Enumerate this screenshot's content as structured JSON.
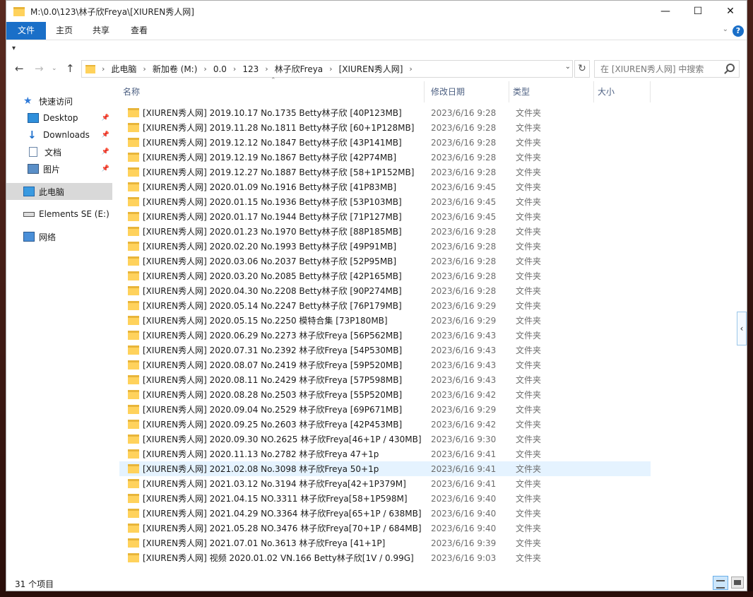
{
  "window": {
    "title": "M:\\0.0\\123\\林子欣Freya\\[XIUREN秀人网]",
    "controls": {
      "minimize": "—",
      "maximize": "☐",
      "close": "✕"
    }
  },
  "ribbon": {
    "tabs": [
      "文件",
      "主页",
      "共享",
      "查看"
    ],
    "accent": "#1a6fc8",
    "help_label": "?"
  },
  "address": {
    "crumbs": [
      "此电脑",
      "新加卷 (M:)",
      "0.0",
      "123",
      "林子欣Freya",
      "[XIUREN秀人网]"
    ]
  },
  "search": {
    "placeholder": "在 [XIUREN秀人网] 中搜索"
  },
  "nav": {
    "items": [
      {
        "label": "快速访问",
        "icon": "star-icon"
      },
      {
        "label": "Desktop",
        "icon": "desktop-icon",
        "pinned": true
      },
      {
        "label": "Downloads",
        "icon": "download-icon",
        "pinned": true
      },
      {
        "label": "文档",
        "icon": "document-icon",
        "pinned": true
      },
      {
        "label": "图片",
        "icon": "picture-icon",
        "pinned": true
      },
      {
        "label": "此电脑",
        "icon": "computer-icon",
        "selected": true
      },
      {
        "label": "Elements SE (E:)",
        "icon": "drive-icon"
      },
      {
        "label": "网络",
        "icon": "network-icon"
      }
    ]
  },
  "columns": {
    "name": "名称",
    "date": "修改日期",
    "type": "类型",
    "size": "大小"
  },
  "files": [
    {
      "name": "[XIUREN秀人网] 2019.10.17 No.1735 Betty林子欣 [40P123MB]",
      "date": "2023/6/16 9:28",
      "type": "文件夹"
    },
    {
      "name": "[XIUREN秀人网] 2019.11.28 No.1811 Betty林子欣 [60+1P128MB]",
      "date": "2023/6/16 9:28",
      "type": "文件夹"
    },
    {
      "name": "[XIUREN秀人网] 2019.12.12 No.1847 Betty林子欣 [43P141MB]",
      "date": "2023/6/16 9:28",
      "type": "文件夹"
    },
    {
      "name": "[XIUREN秀人网] 2019.12.19 No.1867 Betty林子欣 [42P74MB]",
      "date": "2023/6/16 9:28",
      "type": "文件夹"
    },
    {
      "name": "[XIUREN秀人网] 2019.12.27 No.1887 Betty林子欣 [58+1P152MB]",
      "date": "2023/6/16 9:28",
      "type": "文件夹"
    },
    {
      "name": "[XIUREN秀人网] 2020.01.09 No.1916 Betty林子欣 [41P83MB]",
      "date": "2023/6/16 9:45",
      "type": "文件夹"
    },
    {
      "name": "[XIUREN秀人网] 2020.01.15 No.1936 Betty林子欣 [53P103MB]",
      "date": "2023/6/16 9:45",
      "type": "文件夹"
    },
    {
      "name": "[XIUREN秀人网] 2020.01.17 No.1944 Betty林子欣 [71P127MB]",
      "date": "2023/6/16 9:45",
      "type": "文件夹"
    },
    {
      "name": "[XIUREN秀人网] 2020.01.23 No.1970 Betty林子欣 [88P185MB]",
      "date": "2023/6/16 9:28",
      "type": "文件夹"
    },
    {
      "name": "[XIUREN秀人网] 2020.02.20 No.1993 Betty林子欣 [49P91MB]",
      "date": "2023/6/16 9:28",
      "type": "文件夹"
    },
    {
      "name": "[XIUREN秀人网] 2020.03.06 No.2037 Betty林子欣 [52P95MB]",
      "date": "2023/6/16 9:28",
      "type": "文件夹"
    },
    {
      "name": "[XIUREN秀人网] 2020.03.20 No.2085 Betty林子欣 [42P165MB]",
      "date": "2023/6/16 9:28",
      "type": "文件夹"
    },
    {
      "name": "[XIUREN秀人网] 2020.04.30 No.2208 Betty林子欣 [90P274MB]",
      "date": "2023/6/16 9:28",
      "type": "文件夹"
    },
    {
      "name": "[XIUREN秀人网] 2020.05.14 No.2247 Betty林子欣 [76P179MB]",
      "date": "2023/6/16 9:29",
      "type": "文件夹"
    },
    {
      "name": "[XIUREN秀人网] 2020.05.15 No.2250 模特合集 [73P180MB]",
      "date": "2023/6/16 9:29",
      "type": "文件夹"
    },
    {
      "name": "[XIUREN秀人网] 2020.06.29 No.2273 林子欣Freya [56P562MB]",
      "date": "2023/6/16 9:43",
      "type": "文件夹"
    },
    {
      "name": "[XIUREN秀人网] 2020.07.31 No.2392 林子欣Freya [54P530MB]",
      "date": "2023/6/16 9:43",
      "type": "文件夹"
    },
    {
      "name": "[XIUREN秀人网] 2020.08.07 No.2419 林子欣Freya [59P520MB]",
      "date": "2023/6/16 9:43",
      "type": "文件夹"
    },
    {
      "name": "[XIUREN秀人网] 2020.08.11 No.2429 林子欣Freya [57P598MB]",
      "date": "2023/6/16 9:43",
      "type": "文件夹"
    },
    {
      "name": "[XIUREN秀人网] 2020.08.28 No.2503 林子欣Freya [55P520MB]",
      "date": "2023/6/16 9:42",
      "type": "文件夹"
    },
    {
      "name": "[XIUREN秀人网] 2020.09.04 No.2529 林子欣Freya [69P671MB]",
      "date": "2023/6/16 9:29",
      "type": "文件夹"
    },
    {
      "name": "[XIUREN秀人网] 2020.09.25 No.2603 林子欣Freya [42P453MB]",
      "date": "2023/6/16 9:42",
      "type": "文件夹"
    },
    {
      "name": "[XIUREN秀人网] 2020.09.30 NO.2625 林子欣Freya[46+1P / 430MB]",
      "date": "2023/6/16 9:30",
      "type": "文件夹"
    },
    {
      "name": "[XIUREN秀人网] 2020.11.13 No.2782 林子欣Freya 47+1p",
      "date": "2023/6/16 9:41",
      "type": "文件夹"
    },
    {
      "name": "[XIUREN秀人网] 2021.02.08 No.3098 林子欣Freya 50+1p",
      "date": "2023/6/16 9:41",
      "type": "文件夹",
      "hover": true
    },
    {
      "name": "[XIUREN秀人网] 2021.03.12 No.3194 林子欣Freya[42+1P379M]",
      "date": "2023/6/16 9:41",
      "type": "文件夹"
    },
    {
      "name": "[XIUREN秀人网] 2021.04.15 NO.3311 林子欣Freya[58+1P598M]",
      "date": "2023/6/16 9:40",
      "type": "文件夹"
    },
    {
      "name": "[XIUREN秀人网] 2021.04.29 NO.3364 林子欣Freya[65+1P / 638MB]",
      "date": "2023/6/16 9:40",
      "type": "文件夹"
    },
    {
      "name": "[XIUREN秀人网] 2021.05.28 NO.3476 林子欣Freya[70+1P / 684MB]",
      "date": "2023/6/16 9:40",
      "type": "文件夹"
    },
    {
      "name": "[XIUREN秀人网] 2021.07.01 No.3613 林子欣Freya [41+1P]",
      "date": "2023/6/16 9:39",
      "type": "文件夹"
    },
    {
      "name": "[XIUREN秀人网] 视频 2020.01.02 VN.166 Betty林子欣[1V / 0.99G]",
      "date": "2023/6/16 9:03",
      "type": "文件夹"
    }
  ],
  "status": {
    "item_count": "31 个项目"
  }
}
